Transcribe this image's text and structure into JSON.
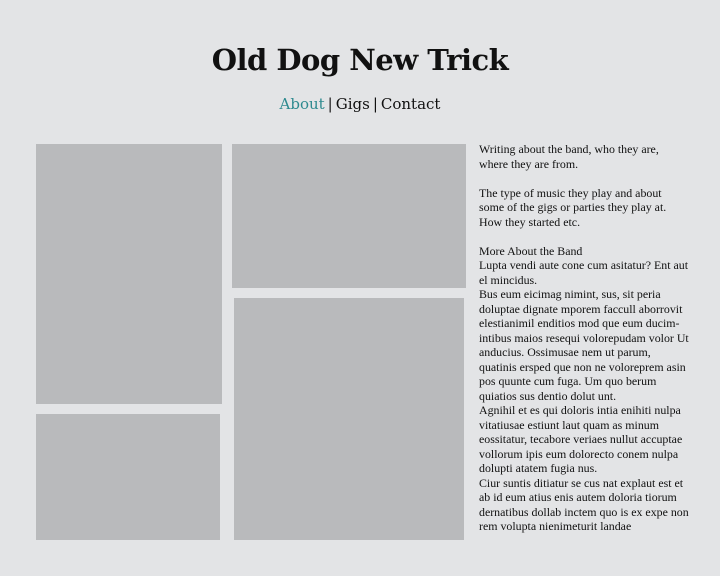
{
  "site": {
    "title": "Old Dog New Trick"
  },
  "nav": {
    "items": [
      {
        "label": "About",
        "active": true
      },
      {
        "label": "Gigs",
        "active": false
      },
      {
        "label": "Contact",
        "active": false
      }
    ],
    "separator": "|",
    "active_color": "#2e8a8f"
  },
  "about": {
    "intro": "Writing about the band,  who they are, where they are from.",
    "music": "The type of music they play and about some of the gigs or parties they play at. How they started etc.",
    "heading": "More About the Band",
    "para1": "Lupta vendi aute cone cum asitatur? Ent aut el mincidus.",
    "para2": "Bus eum eicimag nimint, sus, sit peria doluptae dignate mporem faccull aborrovit elestianimil enditios mod que eum ducim-intibus maios resequi volorepudam volor Ut anducius. Ossimusae nem ut parum, quatinis ersped que non ne voloreprem asin pos quunte cum fuga. Um quo berum quiatios sus dentio dolut unt.",
    "para3": "Agnihil et es qui doloris intia enihiti nulpa vitatiusae estiunt laut quam as minum eossitatur, tecabore veriaes nullut accuptae vollorum ipis eum dolorecto conem nulpa dolupti atatem fugia nus.",
    "para4": "Ciur suntis ditiatur se cus nat explaut est et ab id eum atius enis autem doloria tiorum dernatibus dollab inctem quo is ex expe non rem volupta nienimeturit landae"
  },
  "colors": {
    "background": "#e3e4e6",
    "photo_placeholder": "#b9babc"
  }
}
